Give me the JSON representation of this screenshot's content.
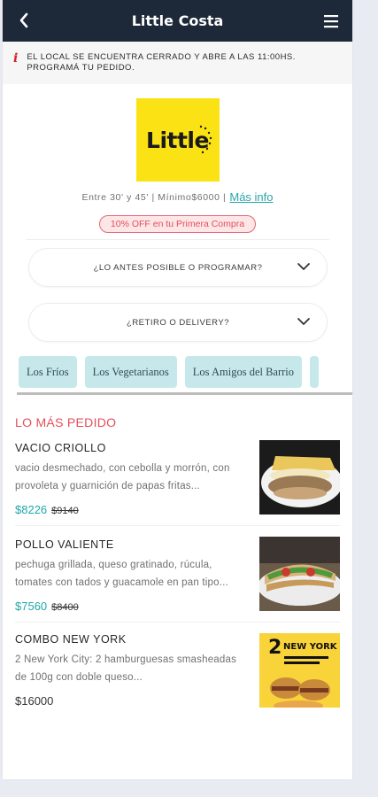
{
  "header": {
    "title": "Little Costa"
  },
  "notice": {
    "icon": "i",
    "text": "El local se encuentra cerrado y abre a las 11:00hs. Programá tu pedido."
  },
  "logo": {
    "text": "Little"
  },
  "meta": {
    "info": "Entre 30' y 45' | Mínimo$6000 |",
    "more_info": "Más info"
  },
  "promo": {
    "text": "10% OFF en tu Primera Compra"
  },
  "dropdowns": [
    {
      "label": "¿Lo antes posible o programar?"
    },
    {
      "label": "¿Retiro o delivery?"
    }
  ],
  "categories": [
    "Los Fríos",
    "Los Vegetarianos",
    "Los Amigos del Barrio"
  ],
  "section": {
    "title": "Lo más pedido"
  },
  "items": [
    {
      "name": "Vacio criollo",
      "description": "vacio desmechado, con cebolla y morrón, con provoleta y guarnición de papas fritas...",
      "price": "$8226",
      "old_price": "$9140"
    },
    {
      "name": "Pollo valiente",
      "description": "pechuga grillada, queso gratinado, rúcula, tomates con tados y guacamole en pan tipo...",
      "price": "$7560",
      "old_price": "$8400"
    },
    {
      "name": "Combo New York",
      "description": "2 New York City: 2 hamburguesas smasheadas de 100g con doble queso...",
      "price": "$16000"
    }
  ],
  "promo_image": {
    "big_number": "2",
    "headline": "NEW YORK"
  },
  "colors": {
    "header_bg": "#1d2838",
    "accent": "#1fa8a8",
    "section": "#e34f5a",
    "logo_bg": "#fbe214"
  }
}
